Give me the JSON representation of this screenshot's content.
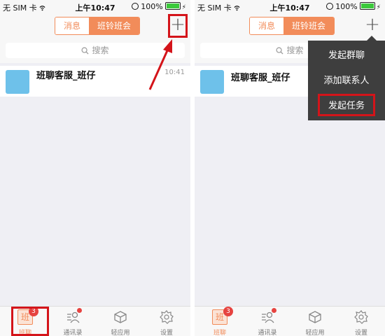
{
  "left_phone": {
    "status": {
      "carrier": "无 SIM 卡",
      "time": "上午10:47",
      "battery": "100%"
    },
    "tabs": {
      "messages": "消息",
      "class_meeting": "班铃班会"
    },
    "plus": "+",
    "search_placeholder": "搜索",
    "chat": {
      "name": "班聊客服_班仔",
      "time": "10:41"
    },
    "bottom_tabs": [
      {
        "label": "班聊",
        "icon": "班",
        "badge": "3"
      },
      {
        "label": "通讯录"
      },
      {
        "label": "轻应用"
      },
      {
        "label": "设置"
      }
    ]
  },
  "right_phone": {
    "status": {
      "carrier": "无 SIM 卡",
      "time": "上午10:47",
      "battery": "100%"
    },
    "tabs": {
      "messages": "消息",
      "class_meeting": "班铃班会"
    },
    "plus": "+",
    "search_placeholder": "搜索",
    "chat": {
      "name": "班聊客服_班仔"
    },
    "menu": {
      "items": [
        "发起群聊",
        "添加联系人",
        "发起任务"
      ]
    },
    "bottom_tabs": [
      {
        "label": "班聊",
        "icon": "班",
        "badge": "3"
      },
      {
        "label": "通讯录"
      },
      {
        "label": "轻应用"
      },
      {
        "label": "设置"
      }
    ]
  },
  "colors": {
    "accent": "#f28c5a",
    "highlight": "#d4141a",
    "menu_bg": "#3e3e3e"
  }
}
